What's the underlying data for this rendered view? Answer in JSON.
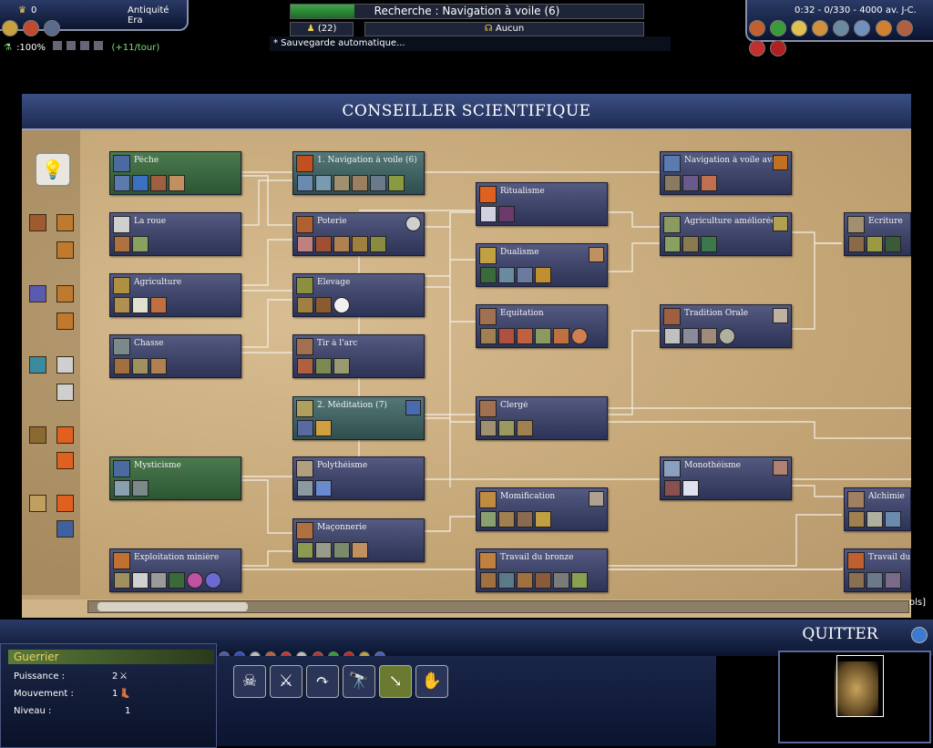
{
  "top_left": {
    "gold": "0",
    "era": "Antiquité Era",
    "science_rate": ":100%",
    "per_turn": "(+11/tour)"
  },
  "research": {
    "label": "Recherche : Navigation à voile (6)",
    "progress": 0.18
  },
  "top_center": {
    "count": "(22)",
    "religion": "Aucun",
    "autosave": "* Sauvegarde automatique..."
  },
  "top_right": {
    "status": "0:32 - 0/330 - 4000 av. J-C."
  },
  "window": {
    "title": "CONSEILLER SCIENTIFIQUE"
  },
  "colors": {
    "known": "#3f6b43",
    "queued": "#4e7272",
    "available": "#3e4468",
    "accent": "#f0d060"
  },
  "techs": {
    "peche": "Pêche",
    "navigation": "1. Navigation à voile (6)",
    "navigation_avancee": "Navigation à voile avancée",
    "roue": "La roue",
    "poterie": "Poterie",
    "ritualisme": "Ritualisme",
    "agriculture_amelioree": "Agriculture améliorée",
    "ecriture": "Ecriture",
    "agriculture": "Agriculture",
    "elevage": "Elevage",
    "dualisme": "Dualisme",
    "chasse": "Chasse",
    "tir_arc": "Tir à l'arc",
    "equitation": "Equitation",
    "tradition_orale": "Tradition Orale",
    "meditation": "2. Méditation (7)",
    "clerge": "Clergé",
    "mysticisme": "Mysticisme",
    "polytheisme": "Polythéisme",
    "monotheisme": "Monothéisme",
    "momification": "Momification",
    "alchimie": "Alchimie",
    "maconnerie": "Maçonnerie",
    "exploitation_miniere": "Exploitation minière",
    "travail_bronze": "Travail du bronze",
    "travail_du": "Travail du"
  },
  "side_hint": "ols]",
  "bottom": {
    "quit": "QUITTER",
    "unit_name": "Guerrier",
    "power_label": "Puissance :",
    "power_value": "2",
    "move_label": "Mouvement :",
    "move_value": "1",
    "level_label": "Niveau :",
    "level_value": "1"
  }
}
